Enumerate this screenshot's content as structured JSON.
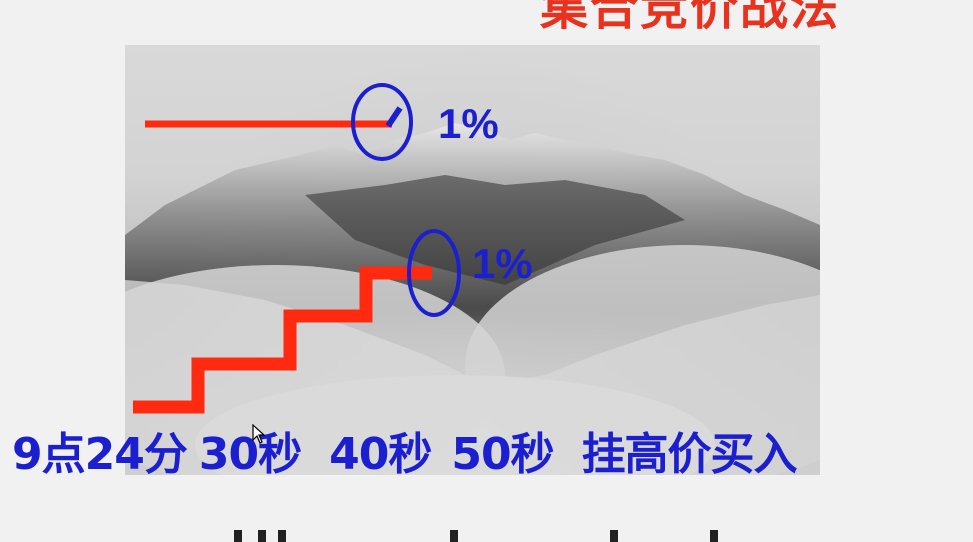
{
  "slide": {
    "title_partial": "集合竞价战法",
    "percent_top": "1%",
    "percent_bottom": "1%",
    "caption": {
      "time": "9点24分",
      "t30": "30秒",
      "t40": "40秒",
      "t50": "50秒",
      "action": "挂高价买入"
    }
  },
  "colors": {
    "line_red": "#ff2a10",
    "circle_blue": "#1b1fd0",
    "text_blue": "#1b1fd0",
    "title_red": "#e8321e"
  },
  "icons": [
    "mouse-cursor-icon"
  ]
}
